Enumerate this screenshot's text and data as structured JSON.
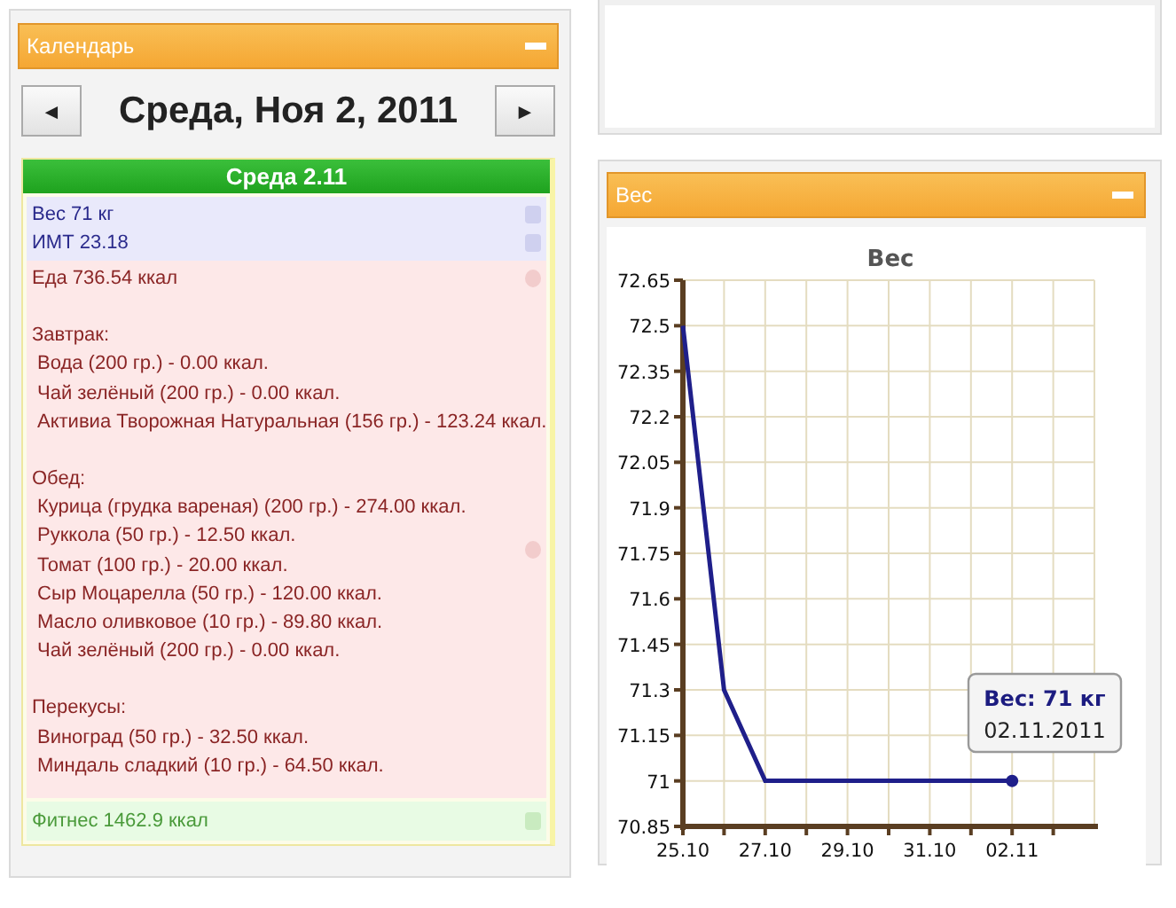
{
  "calendar_panel": {
    "title": "Календарь",
    "prev": "◄",
    "date": "Среда, Ноя 2, 2011",
    "next": "►",
    "day": {
      "title": "Среда 2.11",
      "body": [
        "Вес 71 кг",
        "ИМТ 23.18"
      ],
      "food": {
        "total": "Еда 736.54 ккал",
        "meals": [
          {
            "name": "Завтрак:",
            "items": [
              "Вода (200 гр.) - 0.00 ккал.",
              "Чай зелёный (200 гр.) - 0.00 ккал.",
              "Активиа Творожная Натуральная (156 гр.) - 123.24 ккал."
            ]
          },
          {
            "name": "Обед:",
            "items": [
              "Курица (грудка вареная) (200 гр.) - 274.00 ккал.",
              "Руккола (50 гр.) - 12.50 ккал.",
              "Томат (100 гр.) - 20.00 ккал.",
              "Сыр Моцарелла (50 гр.) - 120.00 ккал.",
              "Масло оливковое (10 гр.) - 89.80 ккал.",
              "Чай зелёный (200 гр.) - 0.00 ккал."
            ]
          },
          {
            "name": "Перекусы:",
            "items": [
              "Виноград (50 гр.) - 32.50 ккал.",
              "Миндаль сладкий (10 гр.) - 64.50 ккал."
            ]
          }
        ]
      },
      "fitness": "Фитнес 1462.9 ккал"
    }
  },
  "weight_panel": {
    "title": "Вес",
    "chart_data": {
      "type": "line",
      "title": "Вес",
      "categories": [
        "25.10",
        null,
        "27.10",
        null,
        "29.10",
        null,
        "31.10",
        null,
        "02.11",
        null
      ],
      "series": [
        {
          "color": "#1f1f8a",
          "values": [
            72.5,
            71.3,
            71,
            null,
            null,
            null,
            null,
            null,
            71,
            null
          ]
        }
      ],
      "ylim": [
        70.85,
        72.65
      ],
      "grid": true,
      "yticks": [
        70.85,
        71,
        71.15,
        71.3,
        71.45,
        71.6,
        71.75,
        71.9,
        72.05,
        72.2,
        72.35,
        72.5,
        72.65
      ]
    },
    "tooltip": {
      "title": "Вес: 71 кг",
      "date": "02.11.2011"
    }
  }
}
